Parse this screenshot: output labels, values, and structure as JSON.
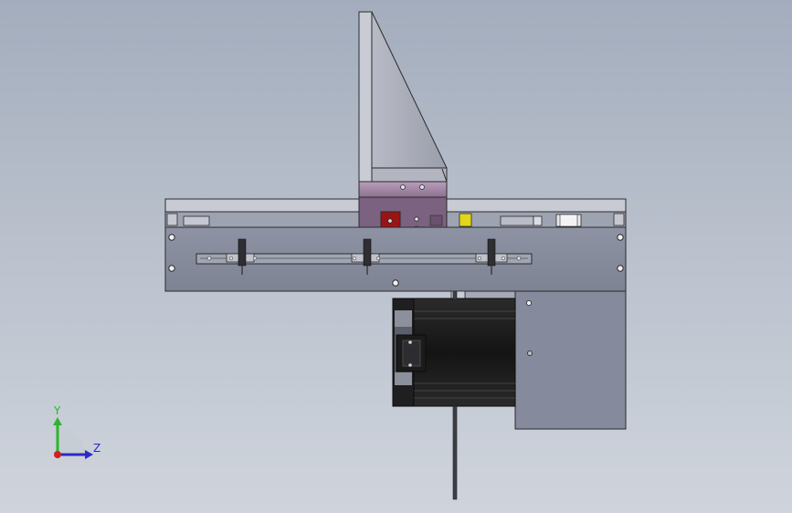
{
  "viewport": {
    "background_top": "#a3adbd",
    "background_bottom": "#cfd4dc"
  },
  "model": {
    "colors": {
      "frame_gray": "#858a9c",
      "frame_light": "#a4a9b8",
      "rail_gray": "#c5c8d2",
      "gusset_gray": "#a5a8b4",
      "slider_mauve": "#a48aa7",
      "slider_dark": "#6e5672",
      "clamp_red": "#9a1414",
      "sensor_yellow": "#e3d61a",
      "motor_black": "#1b1b1b",
      "motor_face": "#7b7f8d"
    },
    "clamp_count": 3,
    "mount_holes": 8
  },
  "triad": {
    "x_axis_color": "#d21f1f",
    "y_axis_color": "#2cb52c",
    "z_axis_color": "#2a2ac9",
    "y_label": "Y",
    "z_label": "Z"
  }
}
